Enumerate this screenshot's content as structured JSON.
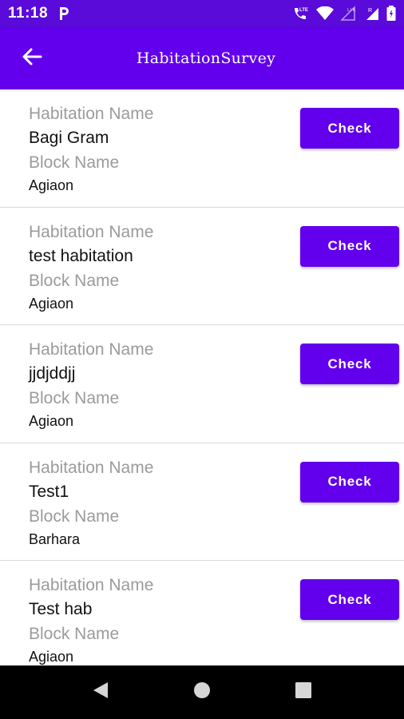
{
  "status_bar": {
    "time": "11:18",
    "notification_icon": "p-icon",
    "icons": [
      "volte-call-icon",
      "wifi-icon",
      "signal-lte-icon",
      "signal-roaming-icon",
      "battery-icon"
    ]
  },
  "app_bar": {
    "title": "HabitationSurvey",
    "back_icon": "arrow-back-icon"
  },
  "labels": {
    "habitation_name": "Habitation Name",
    "block_name": "Block Name",
    "check_button": "Check"
  },
  "habitations": [
    {
      "habitation_name": "Bagi Gram",
      "block_name": "Agiaon"
    },
    {
      "habitation_name": "test habitation",
      "block_name": "Agiaon"
    },
    {
      "habitation_name": "jjdjddjj",
      "block_name": "Agiaon"
    },
    {
      "habitation_name": "Test1",
      "block_name": "Barhara"
    },
    {
      "habitation_name": "Test hab",
      "block_name": "Agiaon"
    }
  ],
  "nav_bar": {
    "icons": [
      "back-triangle-icon",
      "home-circle-icon",
      "recents-square-icon"
    ]
  },
  "colors": {
    "status_bar": "#5a0ad9",
    "primary": "#6200ee",
    "label_gray": "#9b9b9b",
    "divider": "#d9d9d9"
  }
}
